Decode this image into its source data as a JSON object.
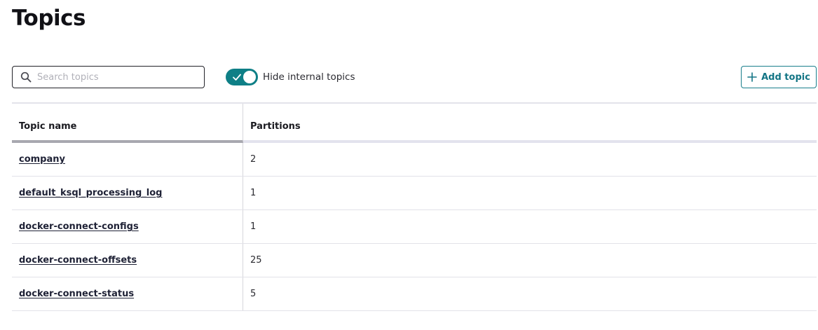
{
  "page": {
    "title": "Topics"
  },
  "search": {
    "placeholder": "Search topics",
    "value": "",
    "icon": "search-icon"
  },
  "toggle": {
    "label": "Hide internal topics",
    "checked": true,
    "color": "#0e7f86"
  },
  "add_button": {
    "label": "Add topic",
    "icon": "plus-icon",
    "color": "#137585"
  },
  "table": {
    "columns": [
      "Topic name",
      "Partitions"
    ],
    "rows": [
      {
        "name": "company",
        "partitions": "2"
      },
      {
        "name": "default_ksql_processing_log",
        "partitions": "1"
      },
      {
        "name": "docker-connect-configs",
        "partitions": "1"
      },
      {
        "name": "docker-connect-offsets",
        "partitions": "25"
      },
      {
        "name": "docker-connect-status",
        "partitions": "5"
      }
    ]
  }
}
